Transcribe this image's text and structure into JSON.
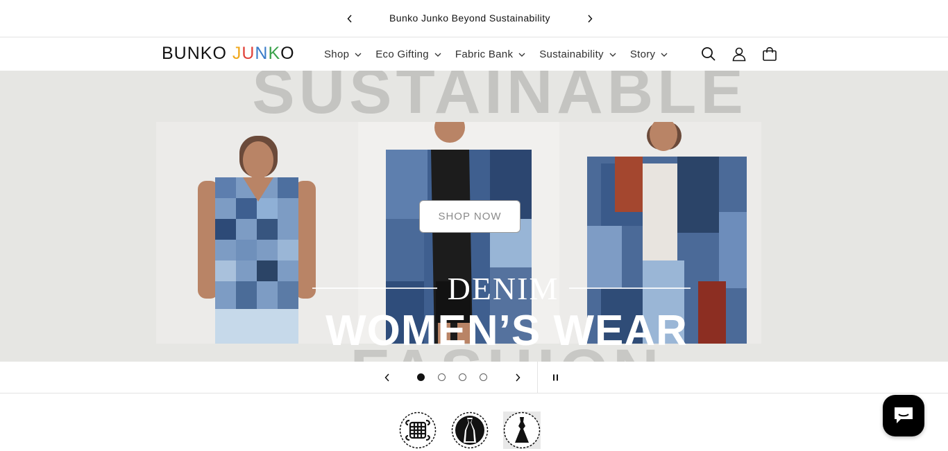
{
  "announcement": {
    "text": "Bunko Junko Beyond Sustainability"
  },
  "logo": {
    "part1": "BUNKO ",
    "letters": [
      {
        "ch": "J",
        "color": "#f0a81c"
      },
      {
        "ch": "U",
        "color": "#e0433b"
      },
      {
        "ch": "N",
        "color": "#3a7cc9"
      },
      {
        "ch": "K",
        "color": "#3aa24b"
      },
      {
        "ch": "O",
        "color": "#121212"
      }
    ]
  },
  "nav": {
    "items": [
      {
        "label": "Shop"
      },
      {
        "label": "Eco Gifting"
      },
      {
        "label": "Fabric Bank"
      },
      {
        "label": "Sustainability"
      },
      {
        "label": "Story"
      }
    ]
  },
  "header_icons": [
    "search-icon",
    "account-icon",
    "cart-icon"
  ],
  "hero": {
    "background_word_top": "SUSTAINABLE",
    "background_word_bottom": "FASHION",
    "denim": "DENIM",
    "headline": "WOMEN’S WEAR",
    "button": "SHOP NOW"
  },
  "slider": {
    "slide_count": 4,
    "active_index": 0
  },
  "categories": [
    "knot-icon",
    "circle-dress-icon",
    "gown-icon"
  ],
  "colors": {
    "text": "#121212",
    "hero_bg": "#e6e6e3",
    "chat_bg": "#000000"
  }
}
